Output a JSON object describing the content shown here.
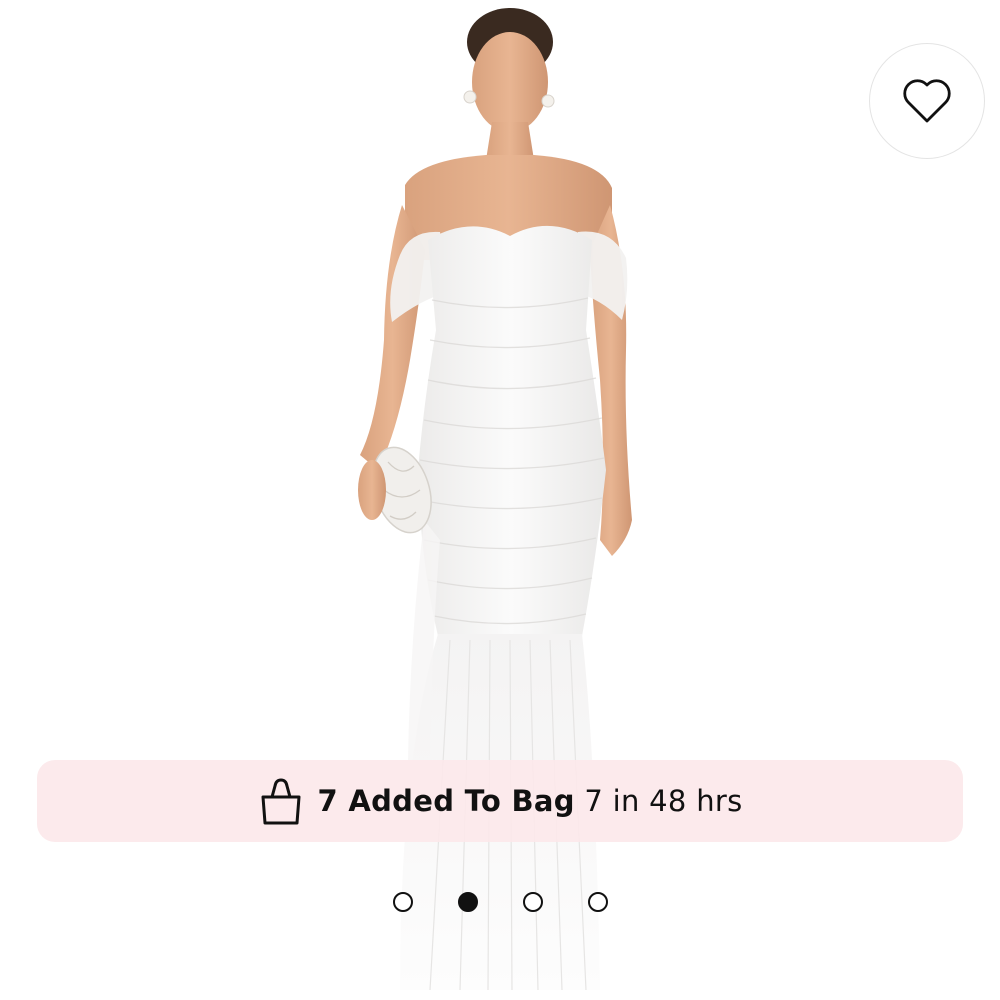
{
  "product": {
    "image_alt": "White off-the-shoulder ruched mermaid gown with clutch"
  },
  "wishlist": {
    "icon": "heart-outline-icon"
  },
  "banner": {
    "icon": "shopping-bag-icon",
    "headline": "7 Added To Bag",
    "detail": "7 in 48 hrs",
    "background": "#FCE8EA"
  },
  "carousel": {
    "total_images": 4,
    "active_index": 1
  }
}
